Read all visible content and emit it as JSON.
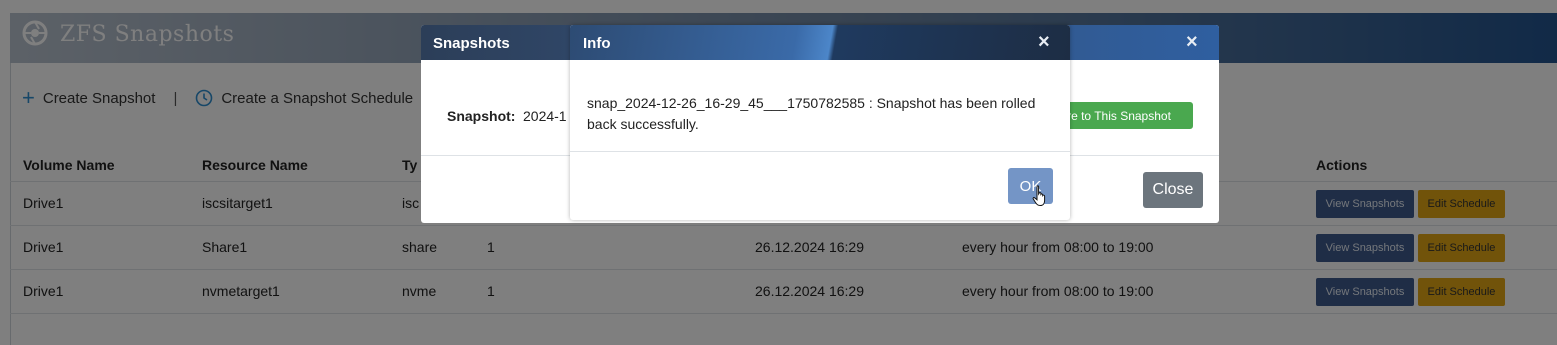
{
  "app": {
    "title": "ZFS Snapshots"
  },
  "toolbar": {
    "create_snapshot": "Create Snapshot",
    "separator": "|",
    "create_schedule": "Create a Snapshot Schedule"
  },
  "table": {
    "headers": [
      "Volume Name",
      "Resource Name",
      "Ty",
      "Actions"
    ],
    "rows": [
      {
        "volume": "Drive1",
        "resource": "iscsitarget1",
        "type": "isc",
        "count": "",
        "date": "",
        "schedule": "",
        "view": "View Snapshots",
        "edit": "Edit Schedule"
      },
      {
        "volume": "Drive1",
        "resource": "Share1",
        "type": "share",
        "count": "1",
        "date": "26.12.2024 16:29",
        "schedule": "every hour from 08:00 to 19:00",
        "view": "View Snapshots",
        "edit": "Edit Schedule"
      },
      {
        "volume": "Drive1",
        "resource": "nvmetarget1",
        "type": "nvme",
        "count": "1",
        "date": "26.12.2024 16:29",
        "schedule": "every hour from 08:00 to 19:00",
        "view": "View Snapshots",
        "edit": "Edit Schedule"
      }
    ]
  },
  "snapshots_modal": {
    "title": "Snapshots",
    "close_glyph": "×",
    "snapshot_label": "Snapshot:",
    "snapshot_value": "2024-1",
    "restore_button": "store to This Snapshot",
    "close_button": "Close"
  },
  "info_modal": {
    "title": "Info",
    "close_glyph": "×",
    "message": "snap_2024-12-26_16-29_45___1750782585 : Snapshot has been rolled back successfully.",
    "ok_button": "OK"
  },
  "colors": {
    "header_gradient_end": "#23548f",
    "view_button": "#3f5b8c",
    "edit_button": "#e3a714",
    "restore_button": "#4aa84f",
    "close_button": "#6c757d",
    "ok_button": "#7495c6"
  },
  "icons": {
    "logo": "aperture-logo-icon",
    "create": "plus-icon",
    "schedule": "clock-icon",
    "cursor": "pointer-hand-icon"
  }
}
